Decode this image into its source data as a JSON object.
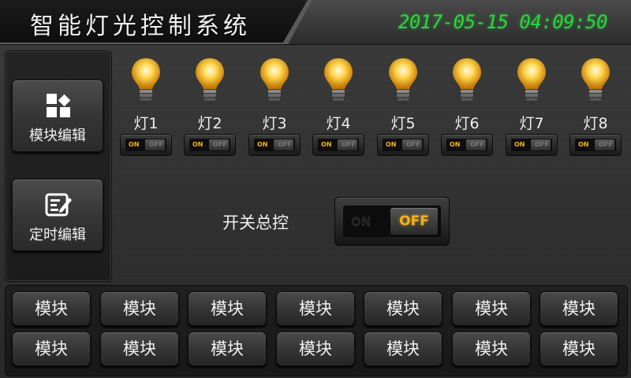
{
  "header": {
    "title": "智能灯光控制系统",
    "date": "2017-05-15",
    "time": "04:09:50",
    "clock_color": "#27d83a"
  },
  "sidebar": {
    "items": [
      {
        "label": "模块编辑",
        "icon": "modules-grid-icon"
      },
      {
        "label": "定时编辑",
        "icon": "edit-timer-icon"
      }
    ]
  },
  "lights": [
    {
      "label": "灯1",
      "switch_on": "ON",
      "switch_off": "OFF",
      "state": "on"
    },
    {
      "label": "灯2",
      "switch_on": "ON",
      "switch_off": "OFF",
      "state": "on"
    },
    {
      "label": "灯3",
      "switch_on": "ON",
      "switch_off": "OFF",
      "state": "on"
    },
    {
      "label": "灯4",
      "switch_on": "ON",
      "switch_off": "OFF",
      "state": "on"
    },
    {
      "label": "灯5",
      "switch_on": "ON",
      "switch_off": "OFF",
      "state": "on"
    },
    {
      "label": "灯6",
      "switch_on": "ON",
      "switch_off": "OFF",
      "state": "on"
    },
    {
      "label": "灯7",
      "switch_on": "ON",
      "switch_off": "OFF",
      "state": "on"
    },
    {
      "label": "灯8",
      "switch_on": "ON",
      "switch_off": "OFF",
      "state": "on"
    }
  ],
  "master": {
    "label": "开关总控",
    "on_text": "ON",
    "off_text": "OFF",
    "accent": "#f6b21d"
  },
  "modules": {
    "row1": [
      "模块",
      "模块",
      "模块",
      "模块",
      "模块",
      "模块",
      "模块"
    ],
    "row2": [
      "模块",
      "模块",
      "模块",
      "模块",
      "模块",
      "模块",
      "模块"
    ]
  }
}
